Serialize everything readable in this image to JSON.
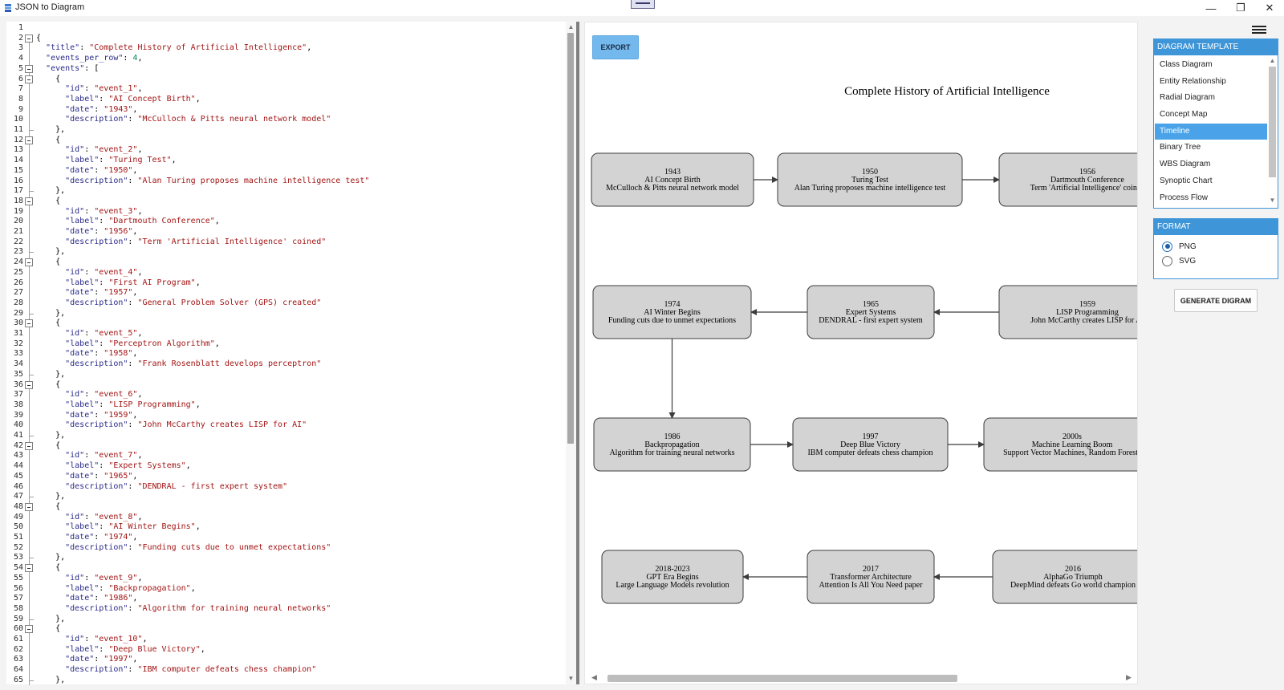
{
  "window": {
    "title": "JSON to Diagram",
    "minimize_glyph": "—",
    "restore_glyph": "❐",
    "close_glyph": "✕"
  },
  "editor": {
    "lines": [
      [],
      [
        [
          "p",
          "{"
        ]
      ],
      [
        [
          "p",
          "  "
        ],
        [
          "k",
          "\"title\""
        ],
        [
          "p",
          ": "
        ],
        [
          "s",
          "\"Complete History of Artificial Intelligence\""
        ],
        [
          "p",
          ","
        ]
      ],
      [
        [
          "p",
          "  "
        ],
        [
          "k",
          "\"events_per_row\""
        ],
        [
          "p",
          ": "
        ],
        [
          "n",
          "4"
        ],
        [
          "p",
          ","
        ]
      ],
      [
        [
          "p",
          "  "
        ],
        [
          "k",
          "\"events\""
        ],
        [
          "p",
          ": ["
        ]
      ],
      [
        [
          "p",
          "    {"
        ]
      ],
      [
        [
          "p",
          "      "
        ],
        [
          "k",
          "\"id\""
        ],
        [
          "p",
          ": "
        ],
        [
          "s",
          "\"event_1\""
        ],
        [
          "p",
          ","
        ]
      ],
      [
        [
          "p",
          "      "
        ],
        [
          "k",
          "\"label\""
        ],
        [
          "p",
          ": "
        ],
        [
          "s",
          "\"AI Concept Birth\""
        ],
        [
          "p",
          ","
        ]
      ],
      [
        [
          "p",
          "      "
        ],
        [
          "k",
          "\"date\""
        ],
        [
          "p",
          ": "
        ],
        [
          "s",
          "\"1943\""
        ],
        [
          "p",
          ","
        ]
      ],
      [
        [
          "p",
          "      "
        ],
        [
          "k",
          "\"description\""
        ],
        [
          "p",
          ": "
        ],
        [
          "s",
          "\"McCulloch & Pitts neural network model\""
        ]
      ],
      [
        [
          "p",
          "    },"
        ]
      ],
      [
        [
          "p",
          "    {"
        ]
      ],
      [
        [
          "p",
          "      "
        ],
        [
          "k",
          "\"id\""
        ],
        [
          "p",
          ": "
        ],
        [
          "s",
          "\"event_2\""
        ],
        [
          "p",
          ","
        ]
      ],
      [
        [
          "p",
          "      "
        ],
        [
          "k",
          "\"label\""
        ],
        [
          "p",
          ": "
        ],
        [
          "s",
          "\"Turing Test\""
        ],
        [
          "p",
          ","
        ]
      ],
      [
        [
          "p",
          "      "
        ],
        [
          "k",
          "\"date\""
        ],
        [
          "p",
          ": "
        ],
        [
          "s",
          "\"1950\""
        ],
        [
          "p",
          ","
        ]
      ],
      [
        [
          "p",
          "      "
        ],
        [
          "k",
          "\"description\""
        ],
        [
          "p",
          ": "
        ],
        [
          "s",
          "\"Alan Turing proposes machine intelligence test\""
        ]
      ],
      [
        [
          "p",
          "    },"
        ]
      ],
      [
        [
          "p",
          "    {"
        ]
      ],
      [
        [
          "p",
          "      "
        ],
        [
          "k",
          "\"id\""
        ],
        [
          "p",
          ": "
        ],
        [
          "s",
          "\"event_3\""
        ],
        [
          "p",
          ","
        ]
      ],
      [
        [
          "p",
          "      "
        ],
        [
          "k",
          "\"label\""
        ],
        [
          "p",
          ": "
        ],
        [
          "s",
          "\"Dartmouth Conference\""
        ],
        [
          "p",
          ","
        ]
      ],
      [
        [
          "p",
          "      "
        ],
        [
          "k",
          "\"date\""
        ],
        [
          "p",
          ": "
        ],
        [
          "s",
          "\"1956\""
        ],
        [
          "p",
          ","
        ]
      ],
      [
        [
          "p",
          "      "
        ],
        [
          "k",
          "\"description\""
        ],
        [
          "p",
          ": "
        ],
        [
          "s",
          "\"Term 'Artificial Intelligence' coined\""
        ]
      ],
      [
        [
          "p",
          "    },"
        ]
      ],
      [
        [
          "p",
          "    {"
        ]
      ],
      [
        [
          "p",
          "      "
        ],
        [
          "k",
          "\"id\""
        ],
        [
          "p",
          ": "
        ],
        [
          "s",
          "\"event_4\""
        ],
        [
          "p",
          ","
        ]
      ],
      [
        [
          "p",
          "      "
        ],
        [
          "k",
          "\"label\""
        ],
        [
          "p",
          ": "
        ],
        [
          "s",
          "\"First AI Program\""
        ],
        [
          "p",
          ","
        ]
      ],
      [
        [
          "p",
          "      "
        ],
        [
          "k",
          "\"date\""
        ],
        [
          "p",
          ": "
        ],
        [
          "s",
          "\"1957\""
        ],
        [
          "p",
          ","
        ]
      ],
      [
        [
          "p",
          "      "
        ],
        [
          "k",
          "\"description\""
        ],
        [
          "p",
          ": "
        ],
        [
          "s",
          "\"General Problem Solver (GPS) created\""
        ]
      ],
      [
        [
          "p",
          "    },"
        ]
      ],
      [
        [
          "p",
          "    {"
        ]
      ],
      [
        [
          "p",
          "      "
        ],
        [
          "k",
          "\"id\""
        ],
        [
          "p",
          ": "
        ],
        [
          "s",
          "\"event_5\""
        ],
        [
          "p",
          ","
        ]
      ],
      [
        [
          "p",
          "      "
        ],
        [
          "k",
          "\"label\""
        ],
        [
          "p",
          ": "
        ],
        [
          "s",
          "\"Perceptron Algorithm\""
        ],
        [
          "p",
          ","
        ]
      ],
      [
        [
          "p",
          "      "
        ],
        [
          "k",
          "\"date\""
        ],
        [
          "p",
          ": "
        ],
        [
          "s",
          "\"1958\""
        ],
        [
          "p",
          ","
        ]
      ],
      [
        [
          "p",
          "      "
        ],
        [
          "k",
          "\"description\""
        ],
        [
          "p",
          ": "
        ],
        [
          "s",
          "\"Frank Rosenblatt develops perceptron\""
        ]
      ],
      [
        [
          "p",
          "    },"
        ]
      ],
      [
        [
          "p",
          "    {"
        ]
      ],
      [
        [
          "p",
          "      "
        ],
        [
          "k",
          "\"id\""
        ],
        [
          "p",
          ": "
        ],
        [
          "s",
          "\"event_6\""
        ],
        [
          "p",
          ","
        ]
      ],
      [
        [
          "p",
          "      "
        ],
        [
          "k",
          "\"label\""
        ],
        [
          "p",
          ": "
        ],
        [
          "s",
          "\"LISP Programming\""
        ],
        [
          "p",
          ","
        ]
      ],
      [
        [
          "p",
          "      "
        ],
        [
          "k",
          "\"date\""
        ],
        [
          "p",
          ": "
        ],
        [
          "s",
          "\"1959\""
        ],
        [
          "p",
          ","
        ]
      ],
      [
        [
          "p",
          "      "
        ],
        [
          "k",
          "\"description\""
        ],
        [
          "p",
          ": "
        ],
        [
          "s",
          "\"John McCarthy creates LISP for AI\""
        ]
      ],
      [
        [
          "p",
          "    },"
        ]
      ],
      [
        [
          "p",
          "    {"
        ]
      ],
      [
        [
          "p",
          "      "
        ],
        [
          "k",
          "\"id\""
        ],
        [
          "p",
          ": "
        ],
        [
          "s",
          "\"event_7\""
        ],
        [
          "p",
          ","
        ]
      ],
      [
        [
          "p",
          "      "
        ],
        [
          "k",
          "\"label\""
        ],
        [
          "p",
          ": "
        ],
        [
          "s",
          "\"Expert Systems\""
        ],
        [
          "p",
          ","
        ]
      ],
      [
        [
          "p",
          "      "
        ],
        [
          "k",
          "\"date\""
        ],
        [
          "p",
          ": "
        ],
        [
          "s",
          "\"1965\""
        ],
        [
          "p",
          ","
        ]
      ],
      [
        [
          "p",
          "      "
        ],
        [
          "k",
          "\"description\""
        ],
        [
          "p",
          ": "
        ],
        [
          "s",
          "\"DENDRAL - first expert system\""
        ]
      ],
      [
        [
          "p",
          "    },"
        ]
      ],
      [
        [
          "p",
          "    {"
        ]
      ],
      [
        [
          "p",
          "      "
        ],
        [
          "k",
          "\"id\""
        ],
        [
          "p",
          ": "
        ],
        [
          "s",
          "\"event_8\""
        ],
        [
          "p",
          ","
        ]
      ],
      [
        [
          "p",
          "      "
        ],
        [
          "k",
          "\"label\""
        ],
        [
          "p",
          ": "
        ],
        [
          "s",
          "\"AI Winter Begins\""
        ],
        [
          "p",
          ","
        ]
      ],
      [
        [
          "p",
          "      "
        ],
        [
          "k",
          "\"date\""
        ],
        [
          "p",
          ": "
        ],
        [
          "s",
          "\"1974\""
        ],
        [
          "p",
          ","
        ]
      ],
      [
        [
          "p",
          "      "
        ],
        [
          "k",
          "\"description\""
        ],
        [
          "p",
          ": "
        ],
        [
          "s",
          "\"Funding cuts due to unmet expectations\""
        ]
      ],
      [
        [
          "p",
          "    },"
        ]
      ],
      [
        [
          "p",
          "    {"
        ]
      ],
      [
        [
          "p",
          "      "
        ],
        [
          "k",
          "\"id\""
        ],
        [
          "p",
          ": "
        ],
        [
          "s",
          "\"event_9\""
        ],
        [
          "p",
          ","
        ]
      ],
      [
        [
          "p",
          "      "
        ],
        [
          "k",
          "\"label\""
        ],
        [
          "p",
          ": "
        ],
        [
          "s",
          "\"Backpropagation\""
        ],
        [
          "p",
          ","
        ]
      ],
      [
        [
          "p",
          "      "
        ],
        [
          "k",
          "\"date\""
        ],
        [
          "p",
          ": "
        ],
        [
          "s",
          "\"1986\""
        ],
        [
          "p",
          ","
        ]
      ],
      [
        [
          "p",
          "      "
        ],
        [
          "k",
          "\"description\""
        ],
        [
          "p",
          ": "
        ],
        [
          "s",
          "\"Algorithm for training neural networks\""
        ]
      ],
      [
        [
          "p",
          "    },"
        ]
      ],
      [
        [
          "p",
          "    {"
        ]
      ],
      [
        [
          "p",
          "      "
        ],
        [
          "k",
          "\"id\""
        ],
        [
          "p",
          ": "
        ],
        [
          "s",
          "\"event_10\""
        ],
        [
          "p",
          ","
        ]
      ],
      [
        [
          "p",
          "      "
        ],
        [
          "k",
          "\"label\""
        ],
        [
          "p",
          ": "
        ],
        [
          "s",
          "\"Deep Blue Victory\""
        ],
        [
          "p",
          ","
        ]
      ],
      [
        [
          "p",
          "      "
        ],
        [
          "k",
          "\"date\""
        ],
        [
          "p",
          ": "
        ],
        [
          "s",
          "\"1997\""
        ],
        [
          "p",
          ","
        ]
      ],
      [
        [
          "p",
          "      "
        ],
        [
          "k",
          "\"description\""
        ],
        [
          "p",
          ": "
        ],
        [
          "s",
          "\"IBM computer defeats chess champion\""
        ]
      ],
      [
        [
          "p",
          "    },"
        ]
      ]
    ],
    "fold_open_lines": [
      2,
      5,
      6,
      12,
      18,
      24,
      30,
      36,
      42,
      48,
      54,
      60
    ],
    "fold_end_lines": [
      11,
      17,
      23,
      29,
      35,
      41,
      47,
      53,
      59,
      65
    ]
  },
  "canvas": {
    "export_label": "EXPORT"
  },
  "diagram": {
    "title": "Complete History of Artificial Intelligence",
    "rows": [
      {
        "direction": "right",
        "nodes": [
          {
            "date": "1943",
            "label": "AI Concept Birth",
            "description": "McCulloch & Pitts neural network model"
          },
          {
            "date": "1950",
            "label": "Turing Test",
            "description": "Alan Turing proposes machine intelligence test"
          },
          {
            "date": "1956",
            "label": "Dartmouth Conference",
            "description": "Term 'Artificial Intelligence' coined"
          }
        ]
      },
      {
        "direction": "left",
        "nodes": [
          {
            "date": "1974",
            "label": "AI Winter Begins",
            "description": "Funding cuts due to unmet expectations"
          },
          {
            "date": "1965",
            "label": "Expert Systems",
            "description": "DENDRAL - first expert system"
          },
          {
            "date": "1959",
            "label": "LISP Programming",
            "description": "John McCarthy creates LISP for AI"
          }
        ]
      },
      {
        "direction": "right",
        "nodes": [
          {
            "date": "1986",
            "label": "Backpropagation",
            "description": "Algorithm for training neural networks"
          },
          {
            "date": "1997",
            "label": "Deep Blue Victory",
            "description": "IBM computer defeats chess champion"
          },
          {
            "date": "2000s",
            "label": "Machine Learning Boom",
            "description": "Support Vector Machines, Random Forests"
          }
        ]
      },
      {
        "direction": "left",
        "nodes": [
          {
            "date": "2018-2023",
            "label": "GPT Era Begins",
            "description": "Large Language Models revolution"
          },
          {
            "date": "2017",
            "label": "Transformer Architecture",
            "description": "Attention Is All You Need paper"
          },
          {
            "date": "2016",
            "label": "AlphaGo Triumph",
            "description": "DeepMind defeats Go world champion"
          }
        ]
      }
    ],
    "node_fill": "#d3d3d3",
    "node_stroke": "#3c3c3c"
  },
  "template_panel": {
    "header": "DIAGRAM TEMPLATE",
    "items": [
      "Class Diagram",
      "Entity Relationship",
      "Radial Diagram",
      "Concept Map",
      "Timeline",
      "Binary Tree",
      "WBS Diagram",
      "Synoptic Chart",
      "Process Flow"
    ],
    "selected": "Timeline"
  },
  "format_panel": {
    "header": "FORMAT",
    "options": [
      "PNG",
      "SVG"
    ],
    "selected": "PNG"
  },
  "generate_label": "GENERATE DIGRAM",
  "colors": {
    "accent": "#3e95d8",
    "selected_item": "#4aa3e8",
    "export_button": "#74b9ee"
  }
}
